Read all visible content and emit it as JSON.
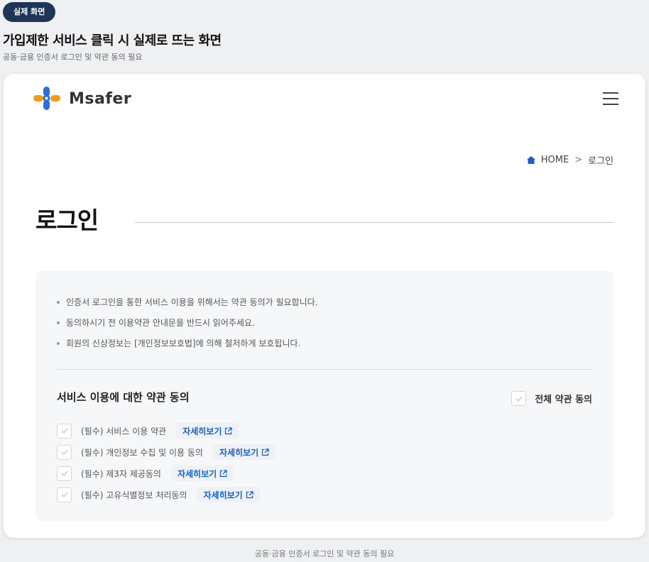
{
  "caption": {
    "badge": "실제 화면",
    "title": "가입제한 서비스 클릭 시 실제로 뜨는 화면",
    "subtitle": "공동·금융 인증서 로그인 및 약관 동의 필요",
    "footer": "공동·금융 인증서 로그인 및 약관 동의 필요"
  },
  "header": {
    "logo_text": "Msafer",
    "menu_icon": "hamburger-icon"
  },
  "breadcrumb": {
    "home": "HOME",
    "separator": ">",
    "current": "로그인"
  },
  "page_title": "로그인",
  "notice": {
    "bullets": [
      "인증서 로그인을 통한 서비스 이용을 위해서는 약관 동의가 필요합니다.",
      "동의하시기 전 이용약관 안내문을 반드시 읽어주세요.",
      "회원의 신상정보는 [개인정보보호법]에 의해 철저하게 보호됩니다."
    ]
  },
  "agreement": {
    "section_title": "서비스 이용에 대한 약관 동의",
    "all_agree_label": "전체 약관 동의",
    "detail_label": "자세히보기",
    "terms": [
      "(필수) 서비스 이용 약관",
      "(필수) 개인정보 수집 및 이용 동의",
      "(필수) 제3자 제공동의",
      "(필수) 고유식별정보 처리동의"
    ]
  },
  "colors": {
    "badge_bg": "#1f3558",
    "link_blue": "#1a5fc9",
    "home_icon": "#1a5fc9",
    "logo_blue": "#2a6ed8",
    "logo_orange": "#f29a1f"
  }
}
